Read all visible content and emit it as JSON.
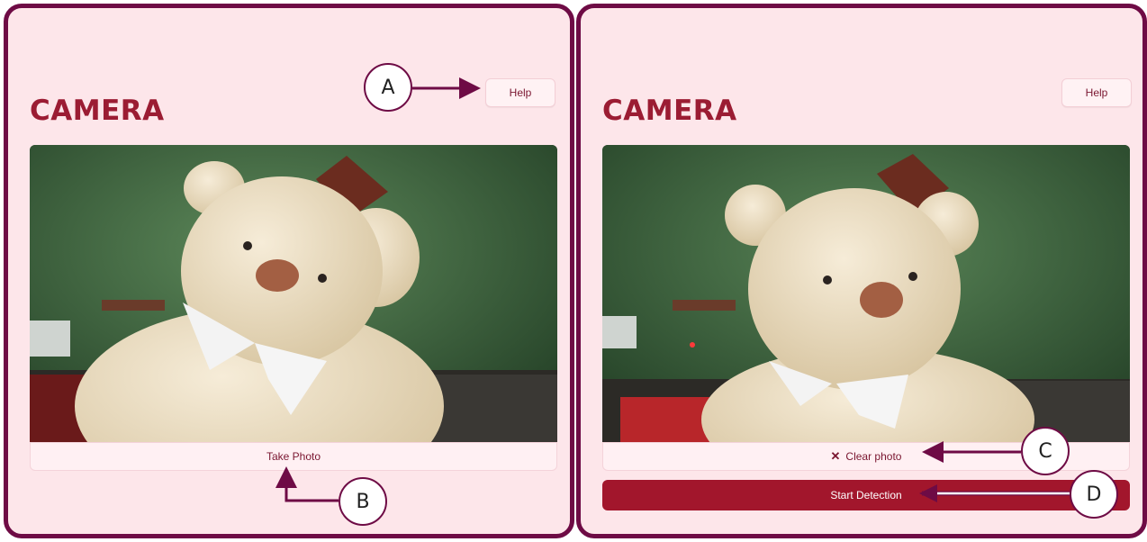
{
  "left_panel": {
    "title": "CAMERA",
    "help_label": "Help",
    "take_photo_label": "Take Photo"
  },
  "right_panel": {
    "title": "CAMERA",
    "help_label": "Help",
    "clear_photo_label": "Clear photo",
    "start_detection_label": "Start Detection"
  },
  "callouts": {
    "a": "A",
    "b": "B",
    "c": "C",
    "d": "D"
  },
  "colors": {
    "panel_background": "#fde6ea",
    "panel_border": "#6e0b45",
    "title": "#9b1c33",
    "primary_button": "#a2162c"
  },
  "icons": {
    "clear": "close-icon"
  }
}
